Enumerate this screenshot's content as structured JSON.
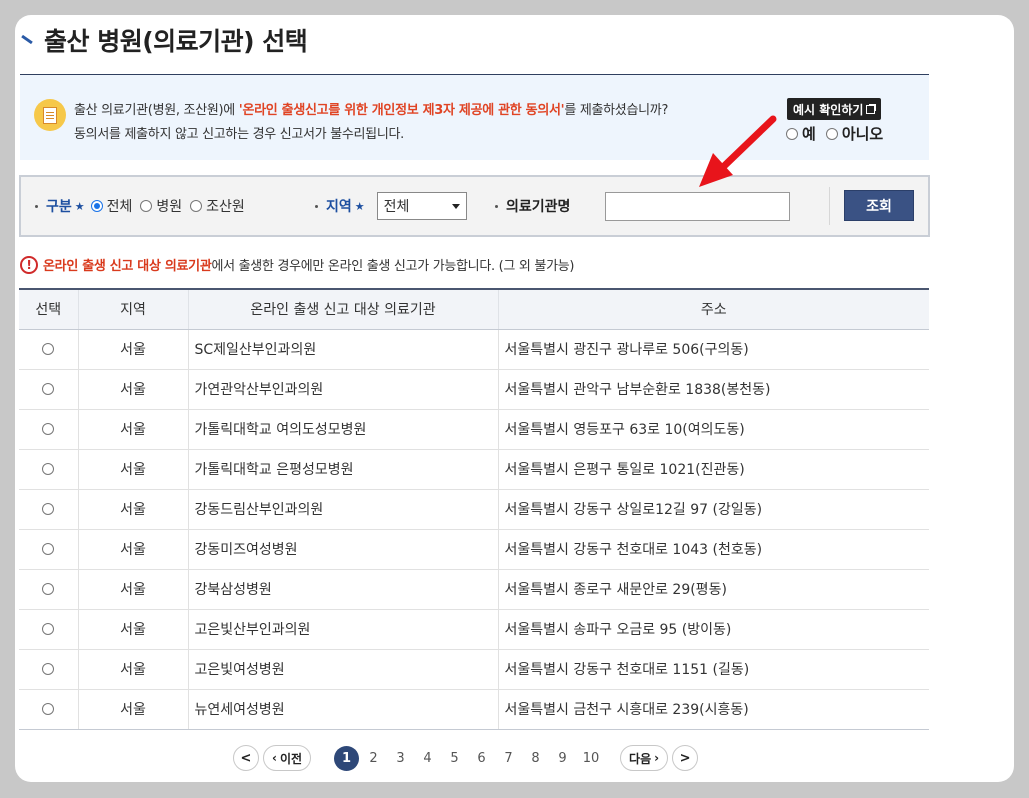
{
  "page": {
    "title": "출산 병원(의료기관) 선택"
  },
  "consent": {
    "text_before": "출산 의료기관(병원, 조산원)에 ",
    "text_highlight": "'온라인 출생신고를 위한 개인정보 제3자 제공에 관한 동의서'",
    "text_after": "를 제출하셨습니까?",
    "line2": "동의서를 제출하지 않고 신고하는 경우 신고서가 불수리됩니다.",
    "example_button": "예시 확인하기",
    "options": [
      "예",
      "아니오"
    ]
  },
  "search": {
    "category_label": "구분",
    "category_options": [
      "전체",
      "병원",
      "조산원"
    ],
    "category_selected": "전체",
    "region_label": "지역",
    "region_value": "전체",
    "institution_label": "의료기관명",
    "institution_value": "",
    "submit_label": "조회"
  },
  "notice": {
    "highlight": "온라인 출생 신고 대상 의료기관",
    "rest": "에서 출생한 경우에만 온라인 출생 신고가 가능합니다. (그 외 불가능)"
  },
  "table": {
    "columns": [
      "선택",
      "지역",
      "온라인 출생 신고 대상 의료기관",
      "주소"
    ],
    "rows": [
      {
        "region": "서울",
        "name": "SC제일산부인과의원",
        "address": "서울특별시 광진구 광나루로 506(구의동)"
      },
      {
        "region": "서울",
        "name": "가연관악산부인과의원",
        "address": "서울특별시 관악구 남부순환로 1838(봉천동)"
      },
      {
        "region": "서울",
        "name": "가톨릭대학교 여의도성모병원",
        "address": "서울특별시 영등포구 63로 10(여의도동)"
      },
      {
        "region": "서울",
        "name": "가톨릭대학교 은평성모병원",
        "address": "서울특별시 은평구 통일로 1021(진관동)"
      },
      {
        "region": "서울",
        "name": "강동드림산부인과의원",
        "address": "서울특별시 강동구 상일로12길 97 (강일동)"
      },
      {
        "region": "서울",
        "name": "강동미즈여성병원",
        "address": "서울특별시 강동구 천호대로 1043 (천호동)"
      },
      {
        "region": "서울",
        "name": "강북삼성병원",
        "address": "서울특별시 종로구 새문안로 29(평동)"
      },
      {
        "region": "서울",
        "name": "고은빛산부인과의원",
        "address": "서울특별시 송파구 오금로 95 (방이동)"
      },
      {
        "region": "서울",
        "name": "고은빛여성병원",
        "address": "서울특별시 강동구 천호대로 1151 (길동)"
      },
      {
        "region": "서울",
        "name": "뉴연세여성병원",
        "address": "서울특별시 금천구 시흥대로 239(시흥동)"
      }
    ]
  },
  "pagination": {
    "prev_label": "이전",
    "next_label": "다음",
    "pages": [
      "1",
      "2",
      "3",
      "4",
      "5",
      "6",
      "7",
      "8",
      "9",
      "10"
    ],
    "current": "1"
  },
  "colors": {
    "accent": "#2e4878",
    "highlight_red": "#e04424",
    "annotation_arrow": "#e8141b"
  }
}
